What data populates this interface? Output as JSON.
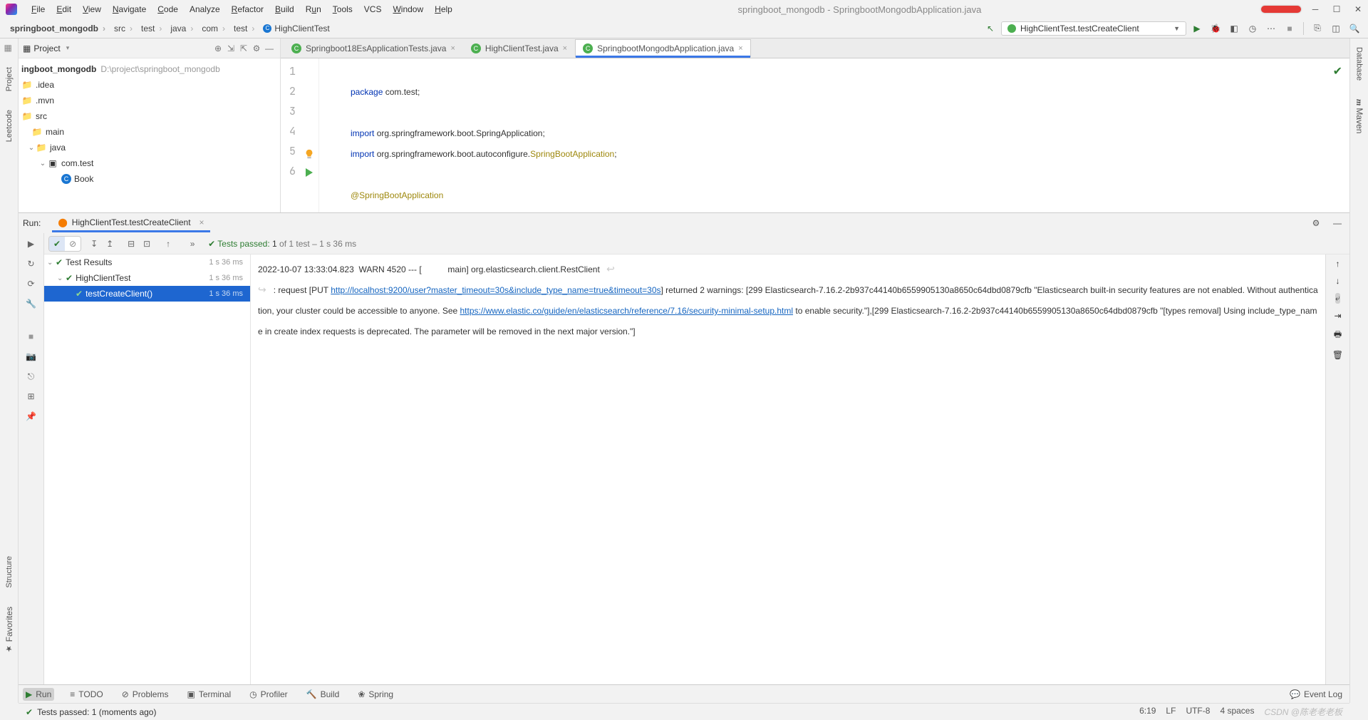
{
  "window": {
    "title": "springboot_mongodb - SpringbootMongodbApplication.java"
  },
  "menu": {
    "file": "File",
    "edit": "Edit",
    "view": "View",
    "navigate": "Navigate",
    "code": "Code",
    "analyze": "Analyze",
    "refactor": "Refactor",
    "build": "Build",
    "run": "Run",
    "tools": "Tools",
    "vcs": "VCS",
    "window": "Window",
    "help": "Help"
  },
  "breadcrumb": {
    "root": "springboot_mongodb",
    "src": "src",
    "test": "test",
    "java": "java",
    "com": "com",
    "pkg": "test",
    "cls": "HighClientTest"
  },
  "runconfig": {
    "name": "HighClientTest.testCreateClient"
  },
  "leftTabs": {
    "project": "Project",
    "leetcode": "Leetcode",
    "structure": "Structure",
    "favorites": "Favorites"
  },
  "rightTabs": {
    "database": "Database",
    "maven": "Maven"
  },
  "projectPanel": {
    "title": "Project",
    "root": "ingboot_mongodb",
    "rootPath": "D:\\project\\springboot_mongodb",
    "idea": ".idea",
    "mvn": ".mvn",
    "src": "src",
    "main": "main",
    "java": "java",
    "comtest": "com.test",
    "book": "Book"
  },
  "tabs": {
    "t1": "Springboot18EsApplicationTests.java",
    "t2": "HighClientTest.java",
    "t3": "SpringbootMongodbApplication.java"
  },
  "code": {
    "l1a": "package ",
    "l1b": "com.test;",
    "l3a": "import ",
    "l3b": "org.springframework.boot.SpringApplication;",
    "l4a": "import ",
    "l4b": "org.springframework.boot.autoconfigure.",
    "l4c": "SpringBootApplication",
    "l4d": ";",
    "l6": "@SpringBootApplication"
  },
  "runTool": {
    "label": "Run:",
    "tab": "HighClientTest.testCreateClient",
    "summary_pre": "Tests passed: ",
    "summary_passed": "1",
    "summary_mid": " of 1 test",
    "summary_time": " – 1 s 36 ms",
    "tree_root": "Test Results",
    "tree_root_time": "1 s 36 ms",
    "tree_cls": "HighClientTest",
    "tree_cls_time": "1 s 36 ms",
    "tree_test": "testCreateClient()",
    "tree_test_time": "1 s 36 ms"
  },
  "console": {
    "p1": "2022-10-07 13:33:04.823  WARN 4520 --- [           main] org.elasticsearch.client.RestClient",
    "p2": "   : request [PUT ",
    "url1": "http://localhost:9200/user?master_timeout=30s&include_type_name=true&timeout=30s",
    "p3": "] returned 2 warnings: [299 Elasticsearch-7.16.2-2b937c44140b6559905130a8650c64dbd0879cfb \"Elasticsearch built-in security features are not enabled. Without authentication, your cluster could be accessible to anyone. See ",
    "url2": "https://www.elastic.co/guide/en/elasticsearch/reference/7.16/security-minimal-setup.html",
    "p4": " to enable security.\"],[299 Elasticsearch-7.16.2-2b937c44140b6559905130a8650c64dbd0879cfb \"[types removal] Using include_type_name in create index requests is deprecated. The parameter will be removed in the next major version.\"]"
  },
  "bottom": {
    "run": "Run",
    "todo": "TODO",
    "problems": "Problems",
    "terminal": "Terminal",
    "profiler": "Profiler",
    "build": "Build",
    "spring": "Spring",
    "eventlog": "Event Log"
  },
  "status": {
    "msg": "Tests passed: 1 (moments ago)",
    "pos": "6:19",
    "le": "LF",
    "enc": "UTF-8",
    "indent": "4 spaces",
    "wm": "CSDN @陈老老老板"
  }
}
